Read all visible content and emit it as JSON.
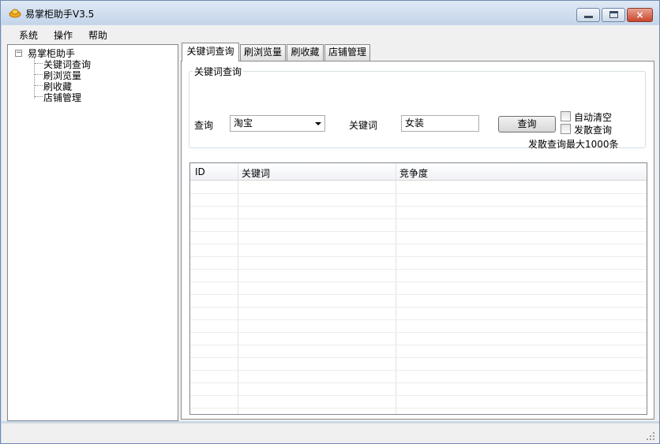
{
  "window": {
    "title": "易掌柜助手V3.5",
    "close_glyph": "×"
  },
  "menubar": {
    "items": [
      "系统",
      "操作",
      "帮助"
    ]
  },
  "tree": {
    "expander_glyph": "−",
    "root": "易掌柜助手",
    "children": [
      "关键词查询",
      "刷浏览量",
      "刷收藏",
      "店铺管理"
    ]
  },
  "tabs": [
    "关键词查询",
    "刷浏览量",
    "刷收藏",
    "店铺管理"
  ],
  "query_group": {
    "title": "关键词查询",
    "query_label": "查询",
    "platform_selected": "淘宝",
    "keyword_label": "关键词",
    "keyword_value": "女装",
    "query_button": "查询",
    "auto_clear_label": "自动清空",
    "auto_clear_checked": false,
    "expand_query_label": "发散查询",
    "expand_query_checked": false,
    "expand_note": "发散查询最大1000条"
  },
  "results_table": {
    "columns": [
      "ID",
      "关键词",
      "竞争度"
    ],
    "rows": []
  },
  "colors": {
    "titlebar": "#c4d5ea",
    "close_button": "#c8452b"
  }
}
